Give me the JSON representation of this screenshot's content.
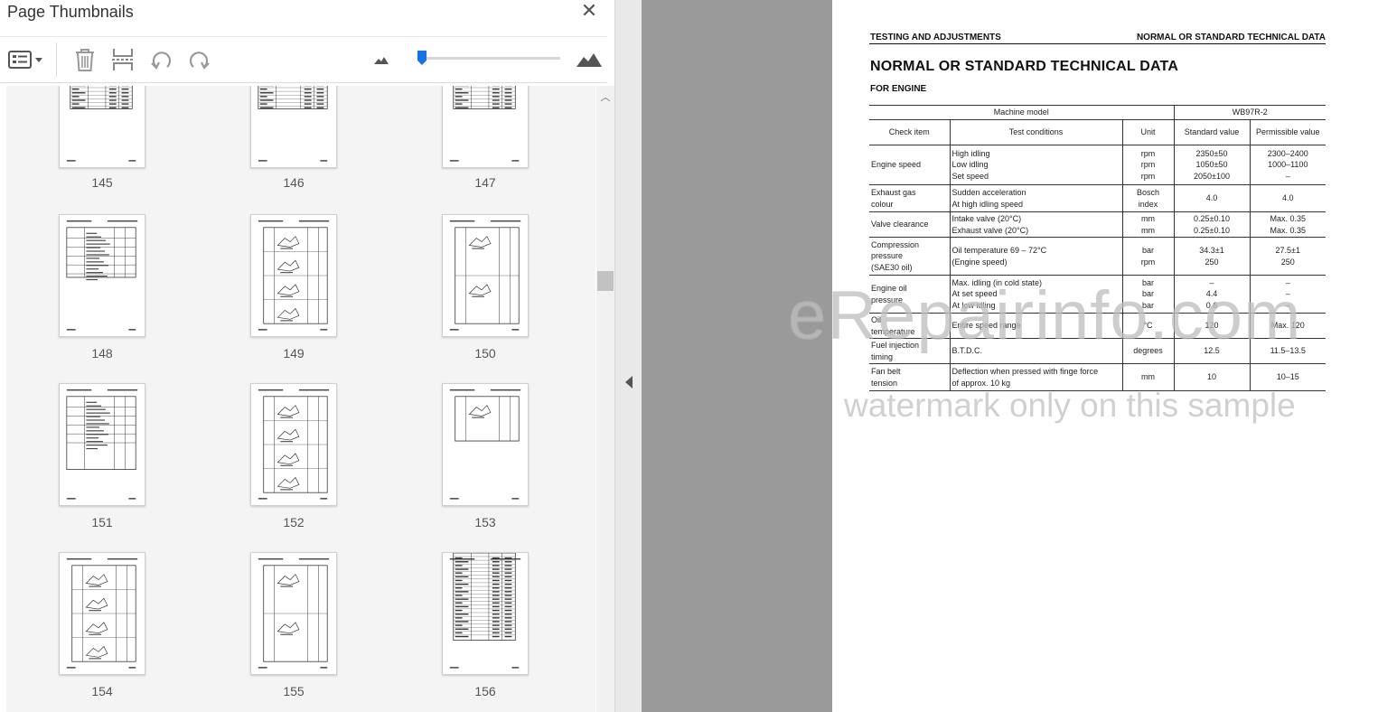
{
  "panel": {
    "title": "Page Thumbnails",
    "close_glyph": "✕"
  },
  "toolbar": {
    "icons": [
      "thumbnail-options-icon",
      "delete-pages-icon",
      "insert-pages-icon",
      "rotate-counterclockwise-icon",
      "rotate-clockwise-icon",
      "zoom-out-icon",
      "zoom-in-icon"
    ],
    "zoom_level": 0.02
  },
  "thumbnails": [
    {
      "label": "145",
      "variant": 1
    },
    {
      "label": "146",
      "variant": 2
    },
    {
      "label": "147",
      "variant": 1
    },
    {
      "label": "148",
      "variant": 3
    },
    {
      "label": "149",
      "variant": 4
    },
    {
      "label": "150",
      "variant": 5
    },
    {
      "label": "151",
      "variant": 6
    },
    {
      "label": "152",
      "variant": 4
    },
    {
      "label": "153",
      "variant": 7
    },
    {
      "label": "154",
      "variant": 8
    },
    {
      "label": "155",
      "variant": 5
    },
    {
      "label": "156",
      "variant": 9
    }
  ],
  "document": {
    "header_left": "TESTING AND ADJUSTMENTS",
    "header_right": "NORMAL OR STANDARD TECHNICAL DATA",
    "title": "NORMAL OR STANDARD TECHNICAL DATA",
    "subtitle": "FOR ENGINE",
    "table": {
      "machine_model_label": "Machine model",
      "machine_model": "WB97R-2",
      "col_headers": [
        "Check item",
        "Test conditions",
        "Unit",
        "Standard value",
        "Permissible value"
      ],
      "rows": [
        {
          "item": [
            "Engine speed"
          ],
          "conditions": [
            "High idling",
            "Low idling",
            "Set speed"
          ],
          "unit": [
            "rpm",
            "rpm",
            "rpm"
          ],
          "standard": [
            "2350±50",
            "1050±50",
            "2050±100"
          ],
          "permissible": [
            "2300–2400",
            "1000–1100",
            "–"
          ]
        },
        {
          "item": [
            "Exhaust gas",
            "colour"
          ],
          "conditions": [
            "Sudden acceleration",
            "At high idling speed"
          ],
          "unit": [
            "Bosch",
            "index"
          ],
          "standard": [
            "4.0"
          ],
          "permissible": [
            "4.0"
          ]
        },
        {
          "item": [
            "Valve clearance"
          ],
          "conditions": [
            "Intake valve (20°C)",
            "Exhaust valve (20°C)"
          ],
          "unit": [
            "mm",
            "mm"
          ],
          "standard": [
            "0.25±0.10",
            "0.25±0.10"
          ],
          "permissible": [
            "Max. 0.35",
            "Max. 0.35"
          ]
        },
        {
          "item": [
            "Compression",
            "pressure",
            "(SAE30 oil)"
          ],
          "conditions": [
            "Oil temperature 69 – 72°C",
            "(Engine speed)"
          ],
          "unit": [
            "bar",
            "rpm"
          ],
          "standard": [
            "34.3±1",
            "250"
          ],
          "permissible": [
            "27.5±1",
            "250"
          ]
        },
        {
          "item": [
            "Engine oil",
            "pressure"
          ],
          "conditions": [
            "Max. idling (in cold state)",
            "At set speed",
            "At low idling"
          ],
          "unit": [
            "bar",
            "bar",
            "bar"
          ],
          "standard": [
            "–",
            "4.4",
            "0.6"
          ],
          "permissible": [
            "–",
            "–",
            "–"
          ]
        },
        {
          "item": [
            "Oil",
            "temperature"
          ],
          "conditions": [
            "Entire speed range"
          ],
          "unit": [
            "°C"
          ],
          "standard": [
            "120"
          ],
          "permissible": [
            "Max. 120"
          ]
        },
        {
          "item": [
            "Fuel injection",
            "timing"
          ],
          "conditions": [
            "B.T.D.C."
          ],
          "unit": [
            "degrees"
          ],
          "standard": [
            "12.5"
          ],
          "permissible": [
            "11.5–13.5"
          ]
        },
        {
          "item": [
            "Fan belt",
            "tension"
          ],
          "conditions": [
            "Deflection when pressed with finge force",
            "of approx. 10 kg"
          ],
          "unit": [
            "mm"
          ],
          "standard": [
            "10"
          ],
          "permissible": [
            "10–15"
          ]
        }
      ]
    },
    "watermark_main": "eRepairinfo.com",
    "watermark_note": "watermark only on this sample"
  },
  "colors": {
    "panel_bg": "#f4f4f4",
    "document_backdrop": "#9a9a9a",
    "slider_accent": "#1473e6"
  }
}
